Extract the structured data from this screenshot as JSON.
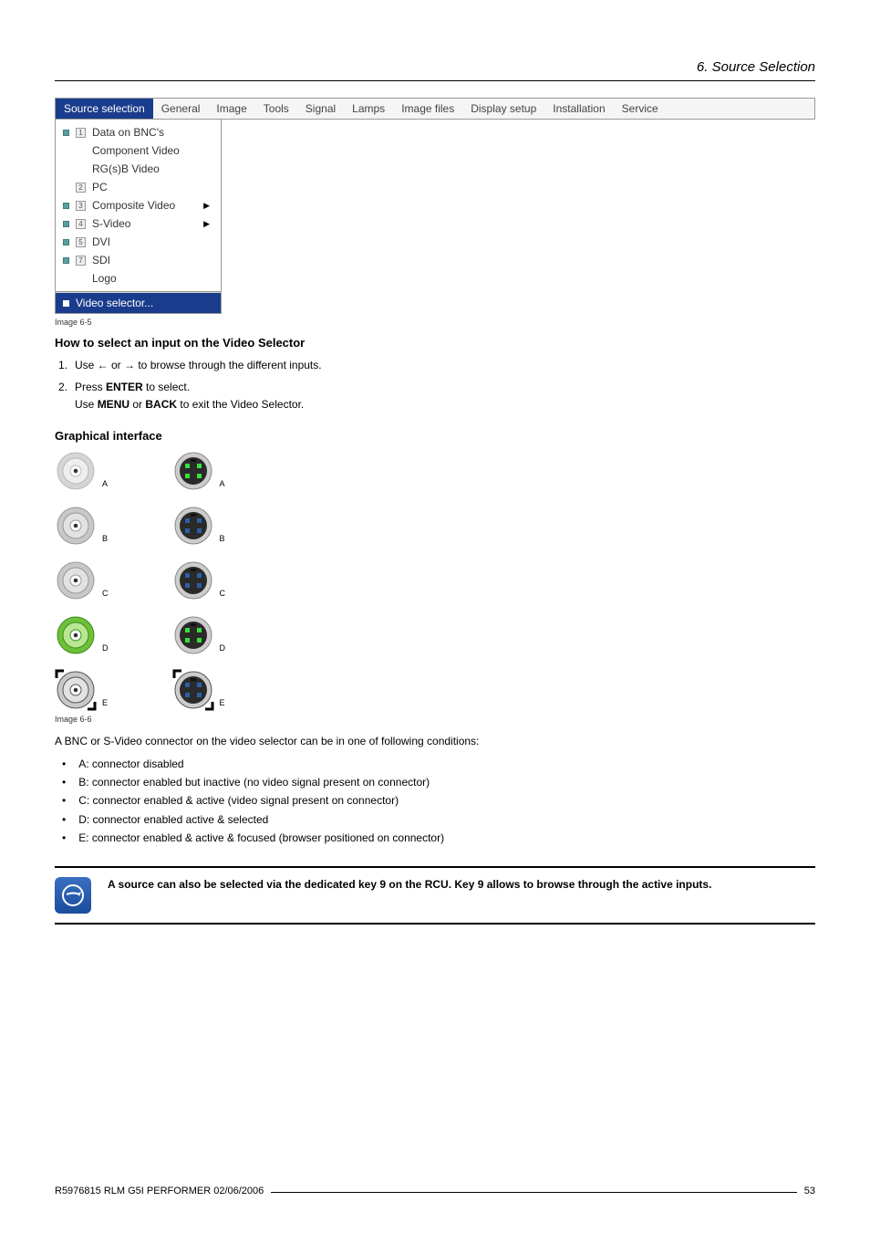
{
  "header": {
    "chapter": "6.  Source Selection"
  },
  "menubar": {
    "tabs": [
      "Source selection",
      "General",
      "Image",
      "Tools",
      "Signal",
      "Lamps",
      "Image files",
      "Display setup",
      "Installation",
      "Service"
    ],
    "active": 0
  },
  "dropdown": {
    "items": [
      {
        "sq": true,
        "num": "1",
        "label": "Data on BNC's"
      },
      {
        "sq": false,
        "num": "",
        "label": "Component Video"
      },
      {
        "sq": false,
        "num": "",
        "label": "RG(s)B Video"
      },
      {
        "sq": false,
        "num": "2",
        "label": "PC"
      },
      {
        "sq": true,
        "num": "3",
        "label": "Composite Video",
        "arrow": true
      },
      {
        "sq": true,
        "num": "4",
        "label": "S-Video",
        "arrow": true
      },
      {
        "sq": true,
        "num": "5",
        "label": "DVI"
      },
      {
        "sq": true,
        "num": "7",
        "label": "SDI"
      },
      {
        "sq": false,
        "num": "",
        "label": "Logo"
      }
    ],
    "footer": "Video selector..."
  },
  "caption_65": "Image 6-5",
  "section_howto": {
    "title": "How to select an input on the Video Selector",
    "steps": [
      {
        "n": "1.",
        "text_pre": "Use ← or → to browse through the different inputs."
      },
      {
        "n": "2.",
        "text_pre": "Press ",
        "bold1": "ENTER",
        "text_mid": " to select.",
        "sub_pre": "Use ",
        "sub_b1": "MENU",
        "sub_mid": " or ",
        "sub_b2": "BACK",
        "sub_post": " to exit the Video Selector."
      }
    ]
  },
  "section_graphical": {
    "title": "Graphical interface",
    "caption": "Image 6-6",
    "rows": [
      "A",
      "B",
      "C",
      "D",
      "E"
    ]
  },
  "conditions": {
    "intro": "A BNC or S-Video connector on the video selector can be in one of following conditions:",
    "items": [
      "A: connector disabled",
      "B: connector enabled but inactive (no video signal present on connector)",
      "C: connector enabled & active (video signal present on connector)",
      "D: connector enabled active & selected",
      "E: connector enabled & active & focused (browser positioned on connector)"
    ]
  },
  "note": "A source can also be selected via the dedicated key 9 on the RCU. Key 9 allows to browse through the active inputs.",
  "footer": {
    "left": "R5976815  RLM G5I PERFORMER  02/06/2006",
    "page": "53"
  }
}
